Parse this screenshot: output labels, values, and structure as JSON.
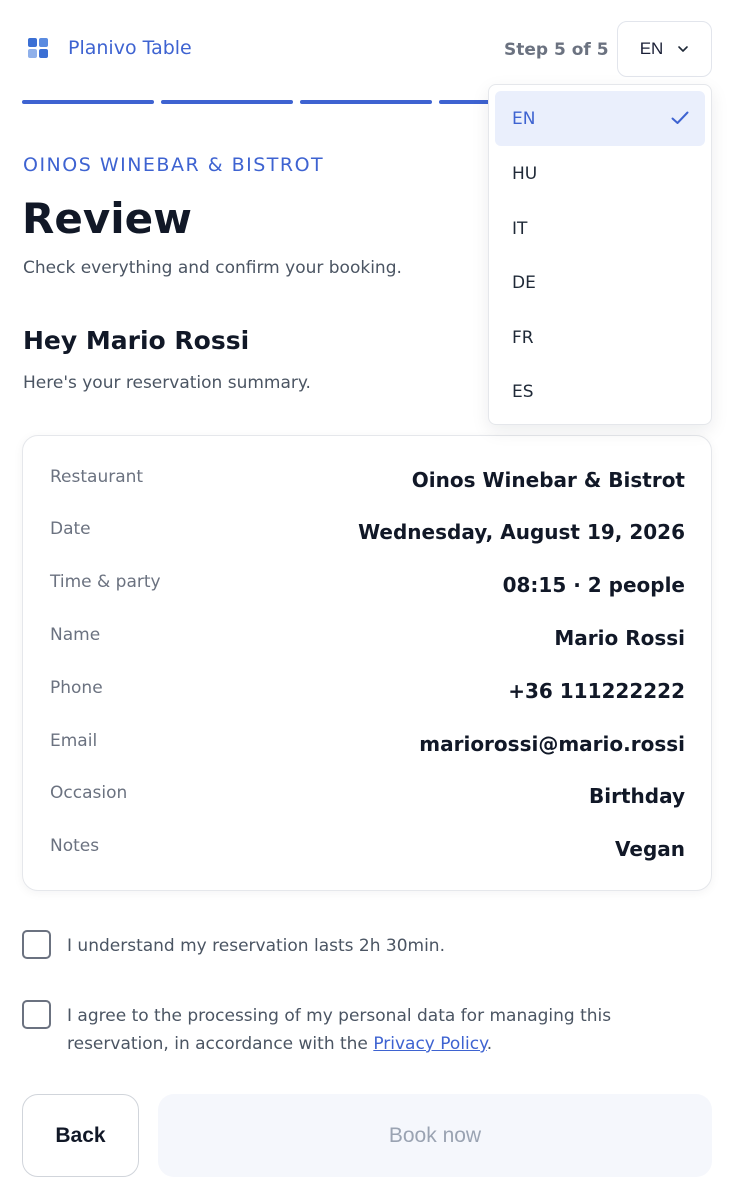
{
  "header": {
    "brand": "Planivo Table",
    "step": "Step 5 of 5",
    "language": "EN",
    "progress_steps_completed": 5
  },
  "language_menu": {
    "selected": "EN",
    "options": [
      "EN",
      "HU",
      "IT",
      "DE",
      "FR",
      "ES"
    ]
  },
  "page": {
    "restaurant_label": "OINOS WINEBAR & BISTROT",
    "title": "Review",
    "subtitle": "Check everything and confirm your booking.",
    "greeting": "Hey Mario Rossi",
    "greeting_sub": "Here's your reservation summary."
  },
  "summary": [
    {
      "label": "Restaurant",
      "value": "Oinos Winebar & Bistrot"
    },
    {
      "label": "Date",
      "value": "Wednesday, August 19, 2026"
    },
    {
      "label": "Time & party",
      "value": "08:15 · 2 people"
    },
    {
      "label": "Name",
      "value": "Mario Rossi"
    },
    {
      "label": "Phone",
      "value": "+36 111222222"
    },
    {
      "label": "Email",
      "value": "mariorossi@mario.rossi"
    },
    {
      "label": "Occasion",
      "value": "Birthday"
    },
    {
      "label": "Notes",
      "value": "Vegan"
    }
  ],
  "consents": {
    "duration": {
      "text": "I understand my reservation lasts 2h 30min.",
      "checked": false
    },
    "privacy": {
      "text_before": "I agree to the processing of my personal data for managing this reservation, in accordance with the ",
      "link": "Privacy Policy",
      "text_after": ".",
      "checked": false
    }
  },
  "actions": {
    "back": "Back",
    "book": "Book now"
  },
  "colors": {
    "accent": "#3e63d1",
    "selected_bg": "#eaeffc",
    "disabled_bg": "#f5f7fc",
    "disabled_text": "#9aa3b2"
  }
}
